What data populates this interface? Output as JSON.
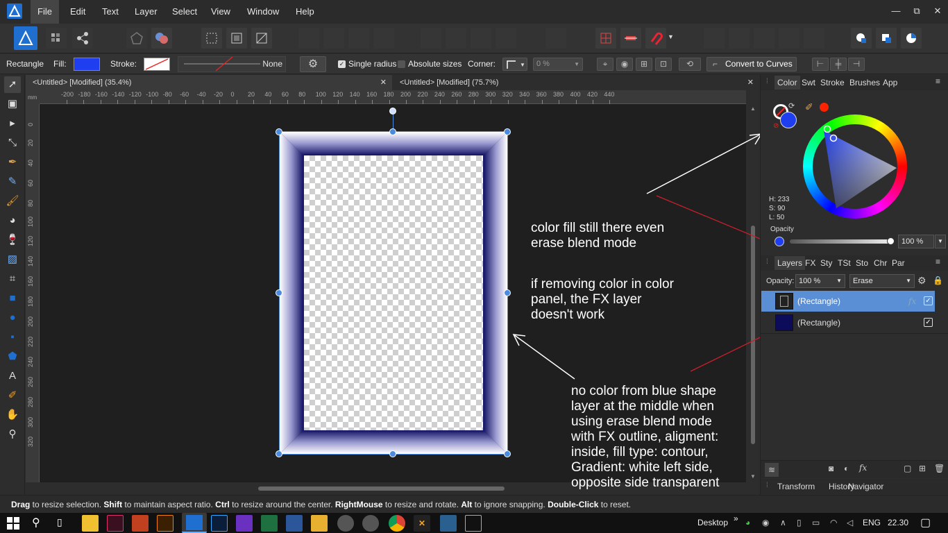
{
  "app": {
    "name": "Affinity Designer",
    "brand_color": "#1f6fd1"
  },
  "menu": {
    "items": [
      "File",
      "Edit",
      "Text",
      "Layer",
      "Select",
      "View",
      "Window",
      "Help"
    ],
    "active": "File"
  },
  "window_controls": {
    "minimize": "—",
    "restore": "⧉",
    "close": "✕"
  },
  "context_toolbar": {
    "tool_name": "Rectangle",
    "fill_label": "Fill:",
    "fill_color": "#1f3ef0",
    "stroke_label": "Stroke:",
    "stroke_style_value": "None",
    "single_radius_label": "Single radius",
    "single_radius_checked": true,
    "absolute_sizes_label": "Absolute sizes",
    "absolute_sizes_checked": false,
    "corner_label": "Corner:",
    "corner_value": "0 %",
    "convert_label": "Convert to Curves"
  },
  "doc_tabs": [
    {
      "label": "<Untitled> [Modified] (35.4%)",
      "close": "✕"
    },
    {
      "label": "<Untitled> [Modified] (75.7%)",
      "close": "✕"
    }
  ],
  "ruler": {
    "unit": "mm",
    "h_ticks": [
      "-200",
      "-180",
      "-160",
      "-140",
      "-120",
      "-100",
      "-80",
      "-60",
      "-40",
      "-20",
      "0",
      "20",
      "40",
      "60",
      "80",
      "100",
      "120",
      "140",
      "160",
      "180",
      "200",
      "220",
      "240",
      "260",
      "280",
      "300",
      "320",
      "340",
      "360",
      "380",
      "400",
      "420",
      "440"
    ],
    "v_ticks": [
      "0",
      "20",
      "40",
      "60",
      "80",
      "100",
      "120",
      "140",
      "160",
      "180",
      "200",
      "220",
      "240",
      "260",
      "280",
      "300",
      "320"
    ]
  },
  "annotations": {
    "note1": [
      "color fill still there even",
      "erase blend mode"
    ],
    "note2": [
      "if removing color in color",
      "panel, the FX layer",
      "doesn't work"
    ],
    "note3": [
      "no color from blue shape",
      "layer at the middle when",
      "using erase blend mode",
      "with FX outline, aligment:",
      "inside, fill type: contour,",
      "Gradient: white left side,",
      "opposite side transparent"
    ]
  },
  "color_panel": {
    "tabs": [
      "Color",
      "Swt",
      "Stroke",
      "Brushes",
      "App"
    ],
    "active_tab": "Color",
    "h_label": "H: 233",
    "s_label": "S: 90",
    "l_label": "L: 50",
    "opacity_label": "Opacity",
    "opacity_value": "100 %",
    "current_color": "#1f3ef0",
    "picker_swatch": "#ff2200"
  },
  "layers_panel": {
    "tabs": [
      "Layers",
      "FX",
      "Sty",
      "TSt",
      "Sto",
      "Chr",
      "Par"
    ],
    "active_tab": "Layers",
    "opacity_label": "Opacity:",
    "opacity_value": "100 %",
    "blend_mode": "Erase",
    "layers": [
      {
        "name": "(Rectangle)",
        "selected": true,
        "visible": true,
        "fx": "fx"
      },
      {
        "name": "(Rectangle)",
        "selected": false,
        "visible": true,
        "fx": ""
      }
    ]
  },
  "bottom_panel_tabs": [
    "Transform",
    "History",
    "Navigator"
  ],
  "status": {
    "parts": [
      {
        "b": "Drag",
        "t": " to resize selection. "
      },
      {
        "b": "Shift",
        "t": " to maintain aspect ratio. "
      },
      {
        "b": "Ctrl",
        "t": " to resize around the center. "
      },
      {
        "b": "RightMouse",
        "t": " to resize and rotate. "
      },
      {
        "b": "Alt",
        "t": " to ignore snapping. "
      },
      {
        "b": "Double-Click",
        "t": " to reset."
      }
    ]
  },
  "taskbar": {
    "desktop_label": "Desktop",
    "lang": "ENG",
    "time": "22.30",
    "chevron": "»"
  }
}
